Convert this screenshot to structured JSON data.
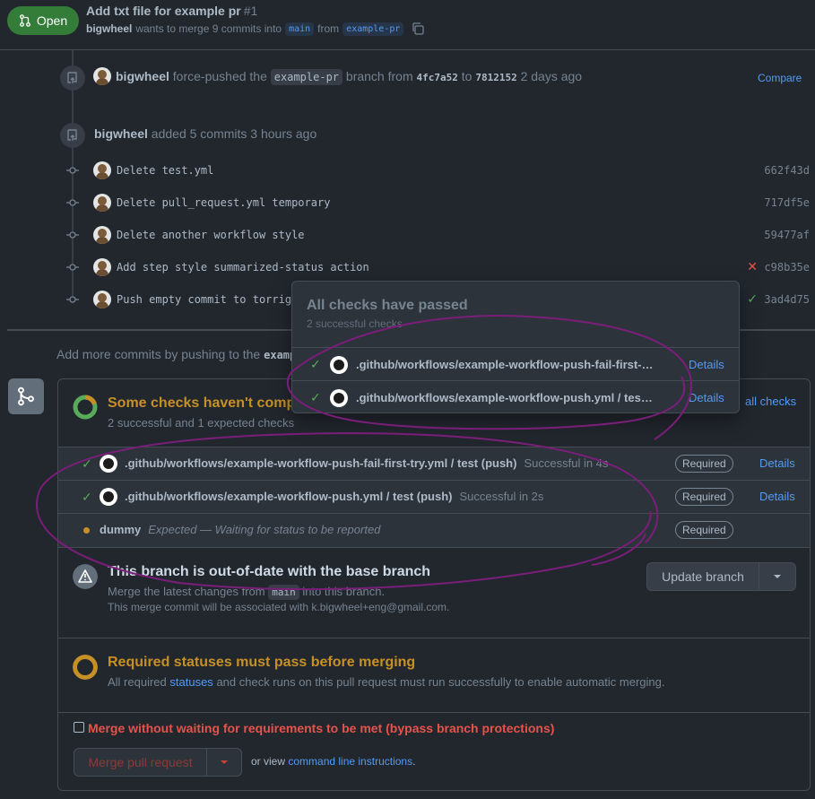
{
  "header": {
    "status_label": "Open",
    "title": "Add txt file for example pr",
    "number": "#1",
    "author": "bigwheel",
    "wants_text": "wants to merge 9 commits into",
    "base_branch": "main",
    "from_text": "from",
    "head_branch": "example-pr"
  },
  "timeline": {
    "force_push": {
      "user": "bigwheel",
      "text_a": "force-pushed the",
      "branch": "example-pr",
      "text_b": "branch from",
      "from_sha": "4fc7a52",
      "text_c": "to",
      "to_sha": "7812152",
      "time": "2 days ago",
      "compare_label": "Compare"
    },
    "added": {
      "user": "bigwheel",
      "text": "added 5 commits 3 hours ago"
    },
    "commits": [
      {
        "message": "Delete test.yml",
        "sha": "662f43d",
        "status": ""
      },
      {
        "message": "Delete pull_request.yml temporary",
        "sha": "717df5e",
        "status": ""
      },
      {
        "message": "Delete another workflow style",
        "sha": "59477af",
        "status": ""
      },
      {
        "message": "Add step style summarized-status action",
        "sha": "c98b35e",
        "status": "✕"
      },
      {
        "message": "Push empty commit to torrig",
        "sha": "3ad4d75",
        "status": "✓"
      }
    ],
    "add_more_text": "Add more commits by pushing to the",
    "add_more_branch": "examp"
  },
  "checks": {
    "title": "Some checks haven't comp",
    "subtitle": "2 successful and 1 expected checks",
    "all_checks_label": "all checks",
    "rows": [
      {
        "name": ".github/workflows/example-workflow-push-fail-first-try.yml / test (push)",
        "desc": "Successful in 4s",
        "badge": "Required",
        "details": "Details"
      },
      {
        "name": ".github/workflows/example-workflow-push.yml / test (push)",
        "desc": "Successful in 2s",
        "badge": "Required",
        "details": "Details"
      },
      {
        "name": "dummy",
        "desc": "Expected — Waiting for status to be reported",
        "badge": "Required",
        "details": ""
      }
    ]
  },
  "outdated": {
    "title": "This branch is out-of-date with the base branch",
    "sub_a": "Merge the latest changes from",
    "sub_branch": "main",
    "sub_b": "into this branch.",
    "sub2": "This merge commit will be associated with k.bigwheel+eng@gmail.com.",
    "update_label": "Update branch"
  },
  "required": {
    "title": "Required statuses must pass before merging",
    "sub_a": "All required",
    "sub_link": "statuses",
    "sub_b": "and check runs on this pull request must run successfully to enable automatic merging."
  },
  "merge": {
    "bypass_label": "Merge without waiting for requirements to be met (bypass branch protections)",
    "merge_label": "Merge pull request",
    "or_view": "or view",
    "cli_link": "command line instructions",
    "period": "."
  },
  "popover": {
    "title": "All checks have passed",
    "subtitle": "2 successful checks",
    "rows": [
      {
        "name": ".github/workflows/example-workflow-push-fail-first-try.yml / test (push)",
        "details": "Details"
      },
      {
        "name": ".github/workflows/example-workflow-push.yml / test (push)",
        "details": "Details"
      }
    ]
  },
  "colors": {
    "success": "#57ab5a",
    "fail": "#e5534b",
    "warning": "#c69026",
    "link": "#539bf5",
    "annotation": "#7a1e7a"
  }
}
